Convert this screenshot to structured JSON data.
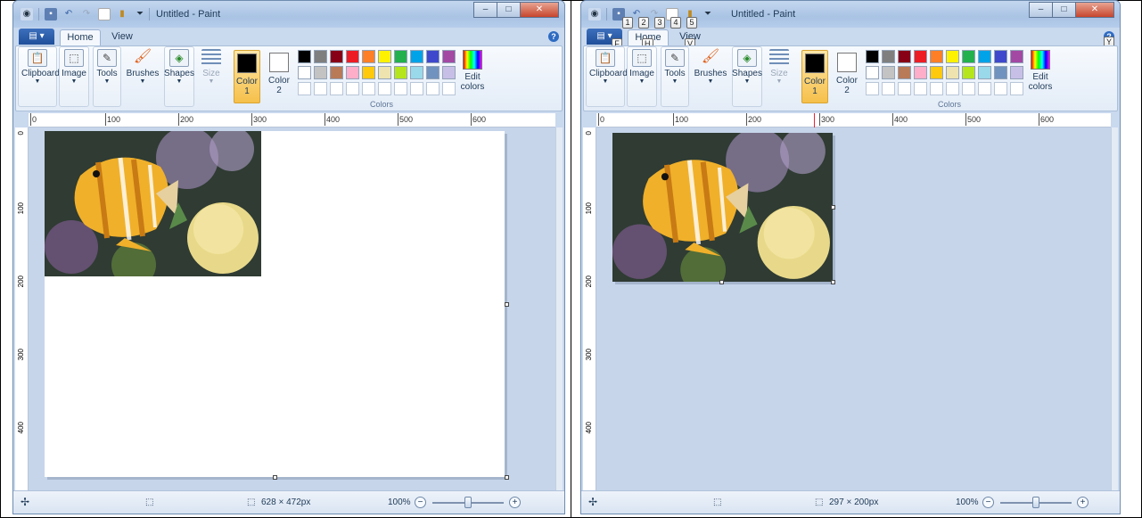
{
  "left": {
    "window_title": "Untitled - Paint",
    "tabs": [
      "Home",
      "View"
    ],
    "groups": {
      "clipboard": "Clipboard",
      "image": "Image",
      "tools": "Tools",
      "brushes": "Brushes",
      "shapes": "Shapes",
      "size": "Size",
      "color1": "Color",
      "color1_num": "1",
      "color2": "Color",
      "color2_num": "2",
      "edit_colors_1": "Edit",
      "edit_colors_2": "colors",
      "colors_caption": "Colors"
    },
    "ruler_h": [
      "0",
      "100",
      "200",
      "300",
      "400",
      "500",
      "600"
    ],
    "ruler_v": [
      "0",
      "100",
      "200",
      "300",
      "400"
    ],
    "status_size": "628 × 472px",
    "zoom": "100%"
  },
  "right": {
    "window_title": "Untitled - Paint",
    "tabs": [
      "Home",
      "View"
    ],
    "groups": {
      "clipboard": "Clipboard",
      "image": "Image",
      "tools": "Tools",
      "brushes": "Brushes",
      "shapes": "Shapes",
      "size": "Size",
      "color1": "Color",
      "color1_num": "1",
      "color2": "Color",
      "color2_num": "2",
      "edit_colors_1": "Edit",
      "edit_colors_2": "colors",
      "colors_caption": "Colors"
    },
    "ruler_h": [
      "0",
      "100",
      "200",
      "300",
      "400",
      "500",
      "600"
    ],
    "ruler_v": [
      "0",
      "100",
      "200",
      "300",
      "400"
    ],
    "status_size": "297 × 200px",
    "zoom": "100%",
    "keytips": {
      "qat": [
        "1",
        "2",
        "3",
        "4",
        "5"
      ],
      "file": "F",
      "home": "H",
      "view": "V",
      "help": "Y"
    }
  },
  "palette": {
    "row1": [
      "#000000",
      "#7f7f7f",
      "#880015",
      "#ed1c24",
      "#ff7f27",
      "#fff200",
      "#22b14c",
      "#00a2e8",
      "#3f48cc",
      "#a349a4"
    ],
    "row2": [
      "#ffffff",
      "#c3c3c3",
      "#b97a57",
      "#ffaec9",
      "#ffc90e",
      "#efe4b0",
      "#b5e61d",
      "#99d9ea",
      "#7092be",
      "#c8bfe7"
    ]
  },
  "icons": {
    "clipboard": "clipboard-icon",
    "image": "select-icon",
    "tools": "pencil-icon",
    "brushes": "brush-icon",
    "shapes": "shapes-icon",
    "size": "line-size-icon"
  }
}
